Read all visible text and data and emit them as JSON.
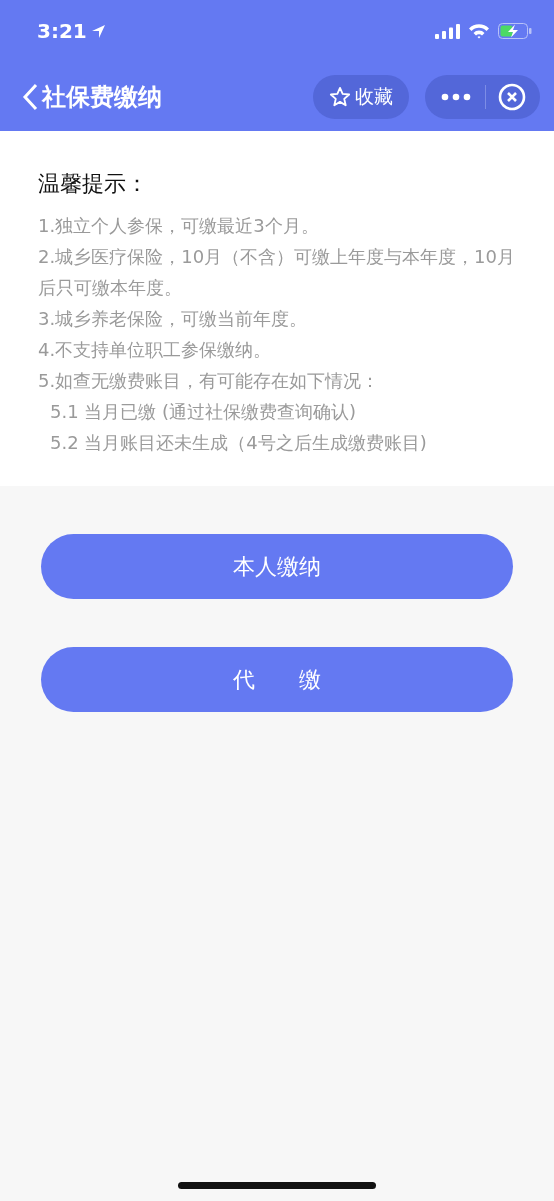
{
  "status_bar": {
    "time": "3:21"
  },
  "nav_bar": {
    "title": "社保费缴纳",
    "favorite_label": "收藏"
  },
  "notice": {
    "title": "温馨提示：",
    "items": [
      {
        "text": "1.独立个人参保，可缴最近3个月。"
      },
      {
        "text": "2.城乡医疗保险，10月（不含）可缴上年度与本年度，10月后只可缴本年度。"
      },
      {
        "text": "3.城乡养老保险，可缴当前年度。"
      },
      {
        "text": "4.不支持单位职工参保缴纳。"
      },
      {
        "text": "5.如查无缴费账目，有可能存在如下情况：",
        "children": [
          {
            "text": "5.1 当月已缴 (通过社保缴费查询确认)"
          },
          {
            "text": "5.2 当月账目还未生成（4号之后生成缴费账目)"
          }
        ]
      }
    ]
  },
  "buttons": [
    "本人缴纳",
    "代　　缴"
  ]
}
